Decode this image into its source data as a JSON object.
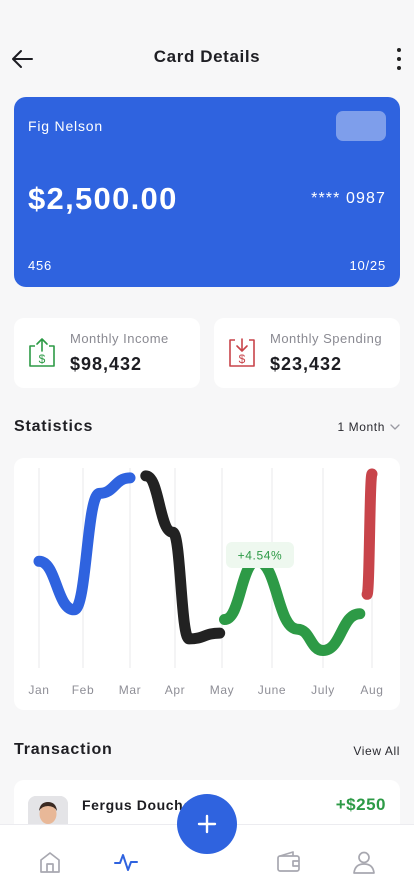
{
  "header": {
    "title": "Card Details",
    "back_icon": "arrow-left-icon",
    "menu_icon": "more-vertical-icon"
  },
  "card": {
    "holder": "Fig Nelson",
    "balance": "$2,500.00",
    "number": "**** 0987",
    "cvv": "456",
    "expiry": "10/25",
    "color": "#2f63df"
  },
  "summary": {
    "income": {
      "label": "Monthly Income",
      "value": "$98,432",
      "icon": "income-dollar-icon",
      "color": "#2d9a46"
    },
    "spending": {
      "label": "Monthly Spending",
      "value": "$23,432",
      "icon": "spending-dollar-icon",
      "color": "#c8444a"
    }
  },
  "statistics": {
    "title": "Statistics",
    "period": "1 Month",
    "chart_data": {
      "type": "line",
      "categories": [
        "Jan",
        "Feb",
        "Mar",
        "Apr",
        "May",
        "June",
        "July",
        "Aug"
      ],
      "annotation": "+4.54%",
      "ylim": [
        0,
        100
      ],
      "grid": "vertical",
      "segments": [
        {
          "color": "#2f63df",
          "points": [
            [
              0,
              55
            ],
            [
              0.8,
              30
            ],
            [
              1.35,
              90
            ],
            [
              2.0,
              98
            ]
          ]
        },
        {
          "color": "#222222",
          "points": [
            [
              2.35,
              99
            ],
            [
              2.95,
              70
            ],
            [
              3.3,
              15
            ],
            [
              3.95,
              18
            ]
          ]
        },
        {
          "color": "#2d9a46",
          "points": [
            [
              4.05,
              25
            ],
            [
              4.7,
              55
            ],
            [
              5.5,
              20
            ],
            [
              6.0,
              9
            ],
            [
              6.75,
              28
            ]
          ]
        },
        {
          "color": "#c8444a",
          "points": [
            [
              6.9,
              38
            ],
            [
              7.2,
              100
            ]
          ]
        }
      ]
    }
  },
  "transactions": {
    "title": "Transaction",
    "view_all": "View All",
    "items": [
      {
        "name": "Fergus Douchebag",
        "amount": "+$250",
        "color": "#2d9a46"
      }
    ]
  },
  "tabbar": {
    "items": [
      "home-icon",
      "activity-icon",
      "wallet-icon",
      "profile-icon"
    ],
    "active": "activity-icon",
    "fab_icon": "plus-icon",
    "accent": "#2f63df"
  }
}
